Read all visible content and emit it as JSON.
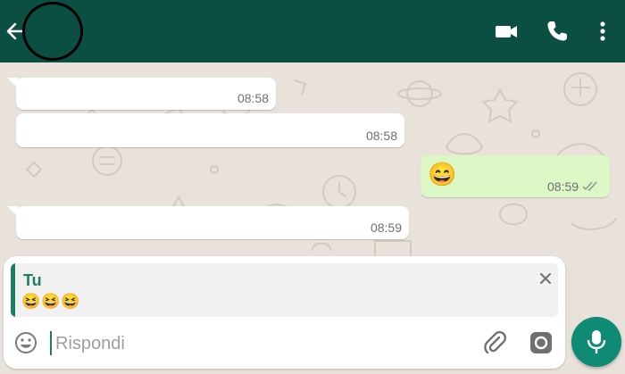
{
  "header": {
    "icons": [
      "back-arrow-icon",
      "video-call-icon",
      "phone-icon",
      "more-vert-icon"
    ],
    "header_color": "#0b4f42"
  },
  "messages": [
    {
      "direction": "incoming",
      "text": "",
      "time": "08:58"
    },
    {
      "direction": "incoming",
      "text": "",
      "time": "08:58"
    },
    {
      "direction": "outgoing",
      "text": "😄",
      "time": "08:59",
      "status": "read"
    },
    {
      "direction": "incoming",
      "text": "",
      "time": "08:59"
    }
  ],
  "reply_preview": {
    "sender": "Tu",
    "text": "😆😆😆"
  },
  "composer": {
    "placeholder": "Rispondi"
  },
  "colors": {
    "outgoing_bubble": "#dcf8c6",
    "incoming_bubble": "#ffffff",
    "accent": "#1e7c66",
    "send_button": "#0f8a74"
  }
}
